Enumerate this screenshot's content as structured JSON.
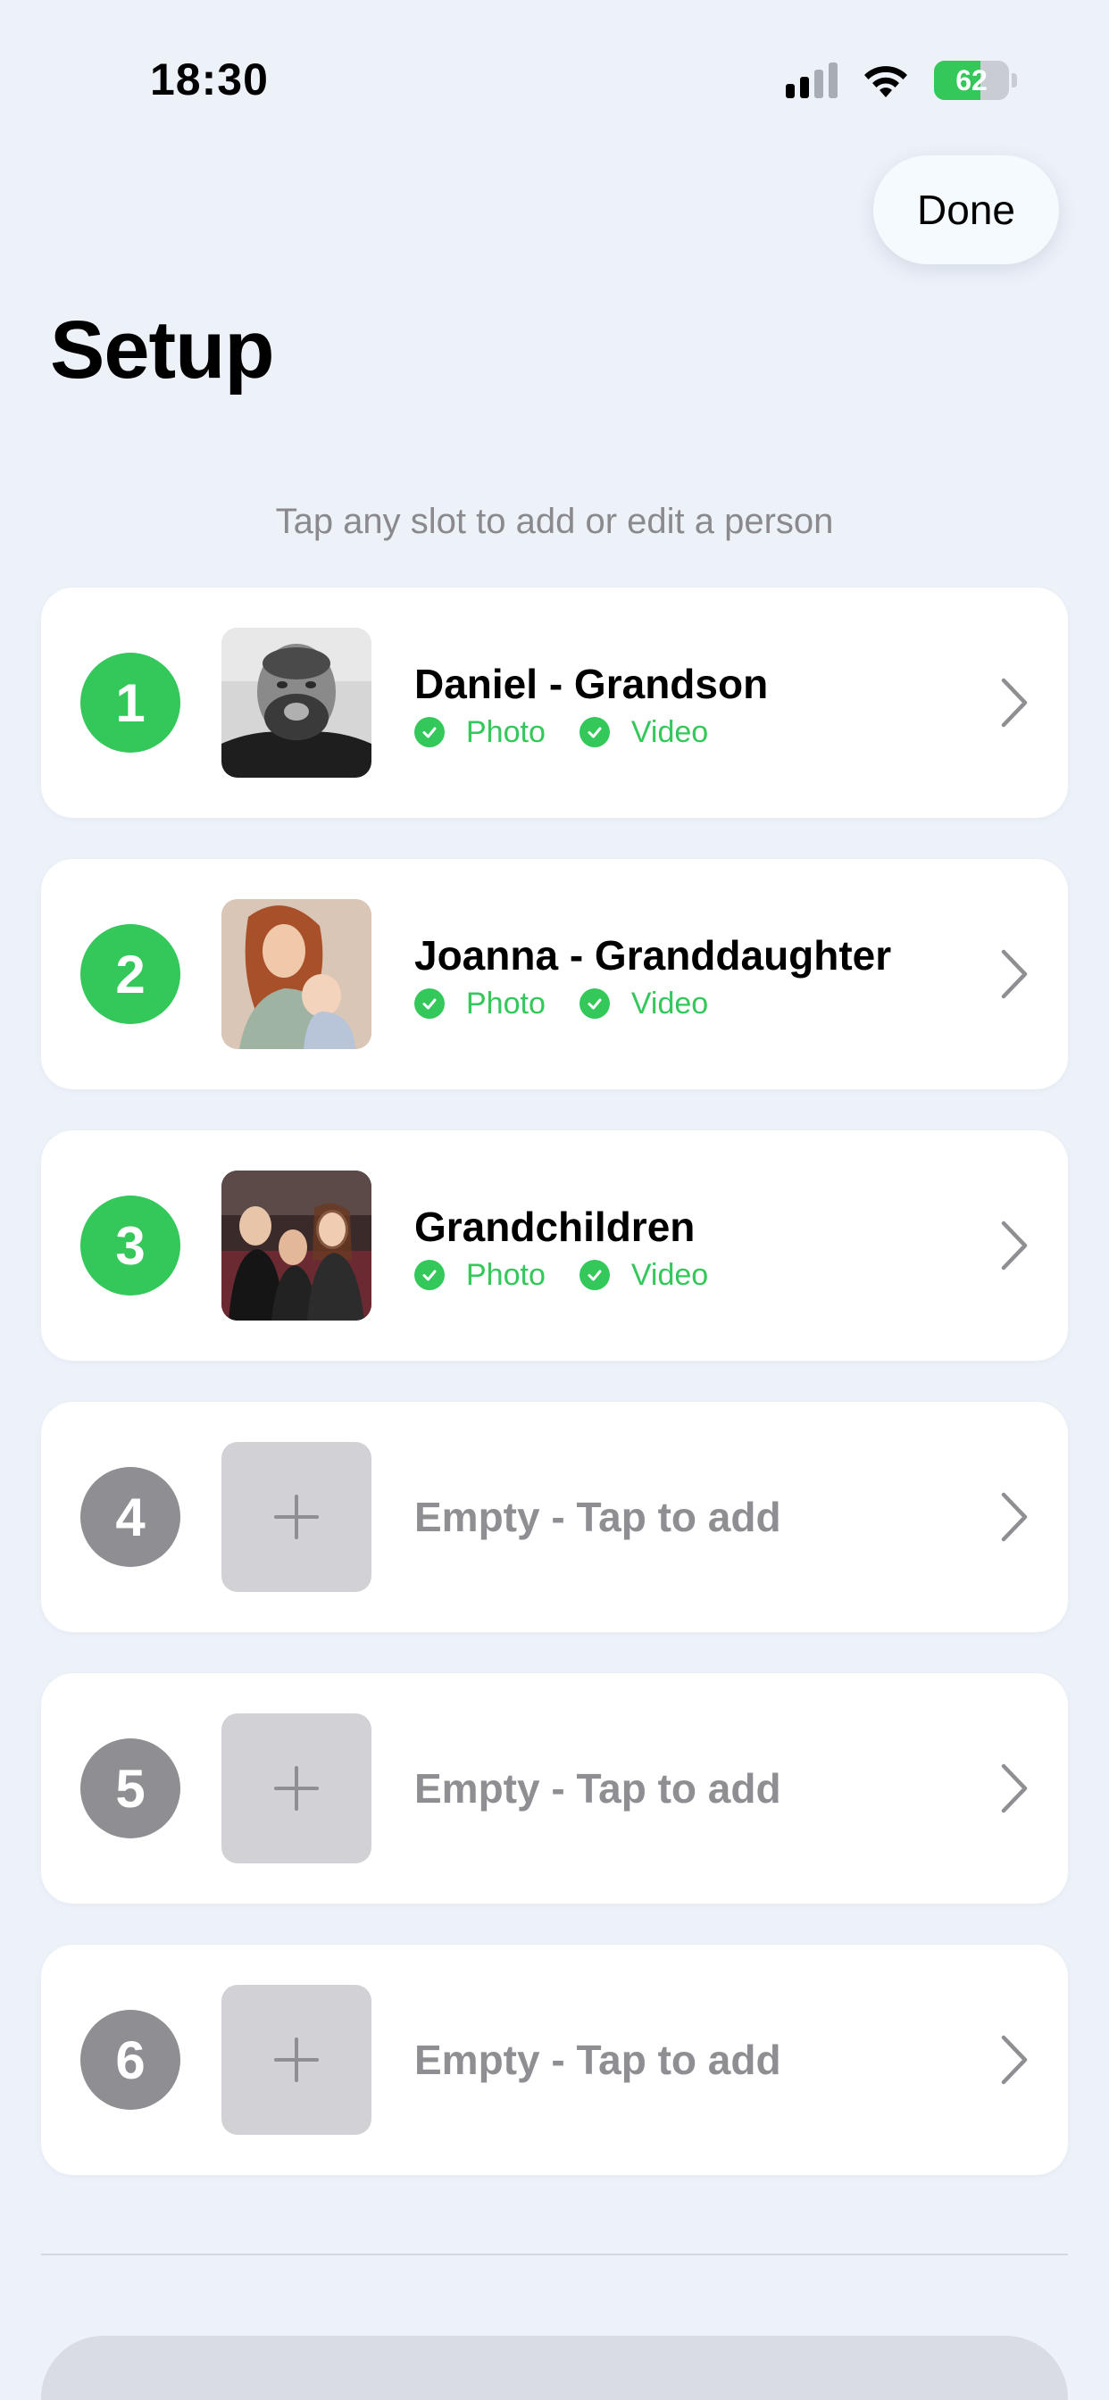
{
  "status_bar": {
    "time": "18:30",
    "battery_percent": "62",
    "battery_level": 0.62,
    "signal_bars_active": 2,
    "signal_bars_total": 4,
    "charging": true
  },
  "header": {
    "done_label": "Done",
    "title": "Setup"
  },
  "hint": "Tap any slot to add or edit a person",
  "colors": {
    "accent_green": "#34c759",
    "empty_gray": "#8e8e93",
    "background": "#edf2f9"
  },
  "slots": [
    {
      "number": "1",
      "name": "Daniel - Grandson",
      "state": "filled",
      "photo_label": "Photo",
      "video_label": "Video"
    },
    {
      "number": "2",
      "name": "Joanna - Granddaughter",
      "state": "filled",
      "photo_label": "Photo",
      "video_label": "Video"
    },
    {
      "number": "3",
      "name": "Grandchildren",
      "state": "filled",
      "photo_label": "Photo",
      "video_label": "Video"
    },
    {
      "number": "4",
      "label": "Empty - Tap to add",
      "state": "empty"
    },
    {
      "number": "5",
      "label": "Empty - Tap to add",
      "state": "empty"
    },
    {
      "number": "6",
      "label": "Empty - Tap to add",
      "state": "empty"
    }
  ]
}
